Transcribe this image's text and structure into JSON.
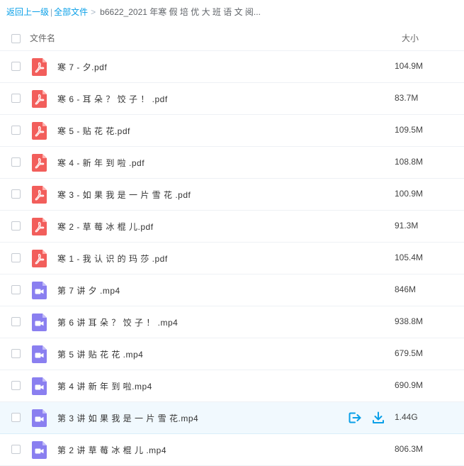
{
  "breadcrumb": {
    "back": "返回上一级",
    "separator": "|",
    "all_files": "全部文件",
    "arrow": ">",
    "current": "b6622_2021 年寒 假 培 优 大 班 语 文 阅..."
  },
  "header": {
    "name_label": "文件名",
    "size_label": "大小"
  },
  "colors": {
    "accent": "#0aa0e8",
    "pdf_icon": "#f25e5b",
    "video_icon": "#8a7ff0",
    "highlight_row": "#f1f9fe"
  },
  "files": [
    {
      "name": "寒 7 - 夕.pdf",
      "size": "104.9M",
      "type": "pdf",
      "icon": "pdf-icon"
    },
    {
      "name": "寒 6 - 耳 朵 ？ 饺 子 ！ .pdf",
      "size": "83.7M",
      "type": "pdf",
      "icon": "pdf-icon"
    },
    {
      "name": "寒 5 - 贴 花 花.pdf",
      "size": "109.5M",
      "type": "pdf",
      "icon": "pdf-icon"
    },
    {
      "name": "寒 4 - 新 年 到 啦 .pdf",
      "size": "108.8M",
      "type": "pdf",
      "icon": "pdf-icon"
    },
    {
      "name": "寒 3 - 如 果 我 是 一 片 雪 花 .pdf",
      "size": "100.9M",
      "type": "pdf",
      "icon": "pdf-icon"
    },
    {
      "name": "寒 2 - 草 莓 冰 棍 儿.pdf",
      "size": "91.3M",
      "type": "pdf",
      "icon": "pdf-icon"
    },
    {
      "name": "寒 1 - 我 认 识 的 玛 莎 .pdf",
      "size": "105.4M",
      "type": "pdf",
      "icon": "pdf-icon"
    },
    {
      "name": "第 7 讲 夕 .mp4",
      "size": "846M",
      "type": "video",
      "icon": "video-icon"
    },
    {
      "name": "第 6 讲 耳 朵 ？ 饺 子 ！ .mp4",
      "size": "938.8M",
      "type": "video",
      "icon": "video-icon"
    },
    {
      "name": "第 5 讲 贴 花 花 .mp4",
      "size": "679.5M",
      "type": "video",
      "icon": "video-icon"
    },
    {
      "name": "第 4 讲 新 年 到 啦.mp4",
      "size": "690.9M",
      "type": "video",
      "icon": "video-icon"
    },
    {
      "name": "第 3 讲 如 果 我 是 一 片 雪 花.mp4",
      "size": "1.44G",
      "type": "video",
      "icon": "video-icon",
      "highlighted": true
    },
    {
      "name": "第 2 讲 草 莓 冰 棍 儿 .mp4",
      "size": "806.3M",
      "type": "video",
      "icon": "video-icon"
    }
  ],
  "row_actions": [
    "share-icon",
    "download-icon"
  ]
}
